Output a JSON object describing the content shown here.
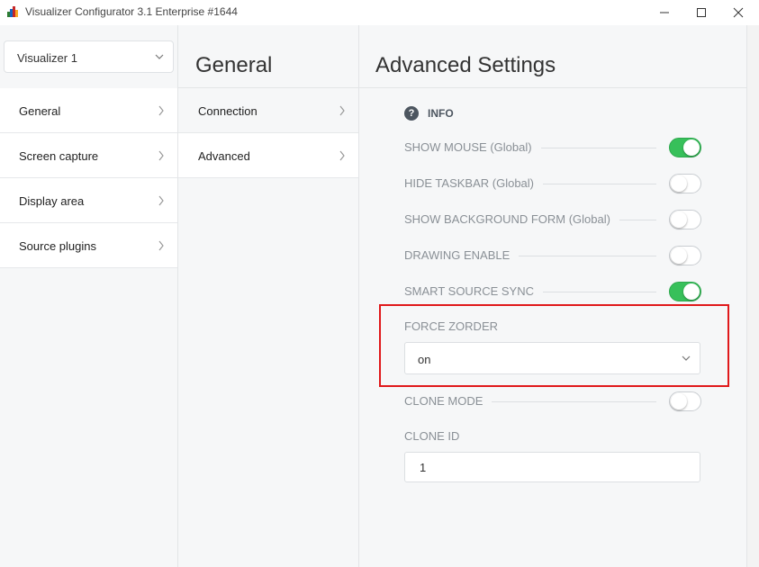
{
  "window": {
    "title": "Visualizer Configurator 3.1 Enterprise #1644",
    "icon_colors": [
      "#2e7d32",
      "#1565c0",
      "#c62828",
      "#f9a825"
    ]
  },
  "colors": {
    "accent_green": "#37c05a",
    "highlight_red": "#e0191b",
    "panel_bg": "#f6f7f8"
  },
  "sidebar": {
    "selector": {
      "value": "Visualizer 1",
      "icon": "chevron-down-icon"
    },
    "items": [
      {
        "label": "General",
        "active": true
      },
      {
        "label": "Screen capture"
      },
      {
        "label": "Display area"
      },
      {
        "label": "Source plugins"
      }
    ]
  },
  "general_panel": {
    "heading": "General",
    "items": [
      {
        "label": "Connection"
      },
      {
        "label": "Advanced",
        "active": true
      }
    ]
  },
  "advanced_panel": {
    "heading": "Advanced Settings",
    "info_label": "INFO",
    "toggles": [
      {
        "label": "SHOW MOUSE (Global)",
        "on": true
      },
      {
        "label": "HIDE TASKBAR (Global)",
        "on": false
      },
      {
        "label": "SHOW BACKGROUND FORM (Global)",
        "on": false
      },
      {
        "label": "DRAWING ENABLE",
        "on": false
      },
      {
        "label": "SMART SOURCE SYNC",
        "on": true
      }
    ],
    "force_zorder": {
      "label": "FORCE ZORDER",
      "value": "on"
    },
    "clone_mode": {
      "label": "CLONE MODE",
      "on": false
    },
    "clone_id": {
      "label": "CLONE ID",
      "value": "1"
    }
  }
}
